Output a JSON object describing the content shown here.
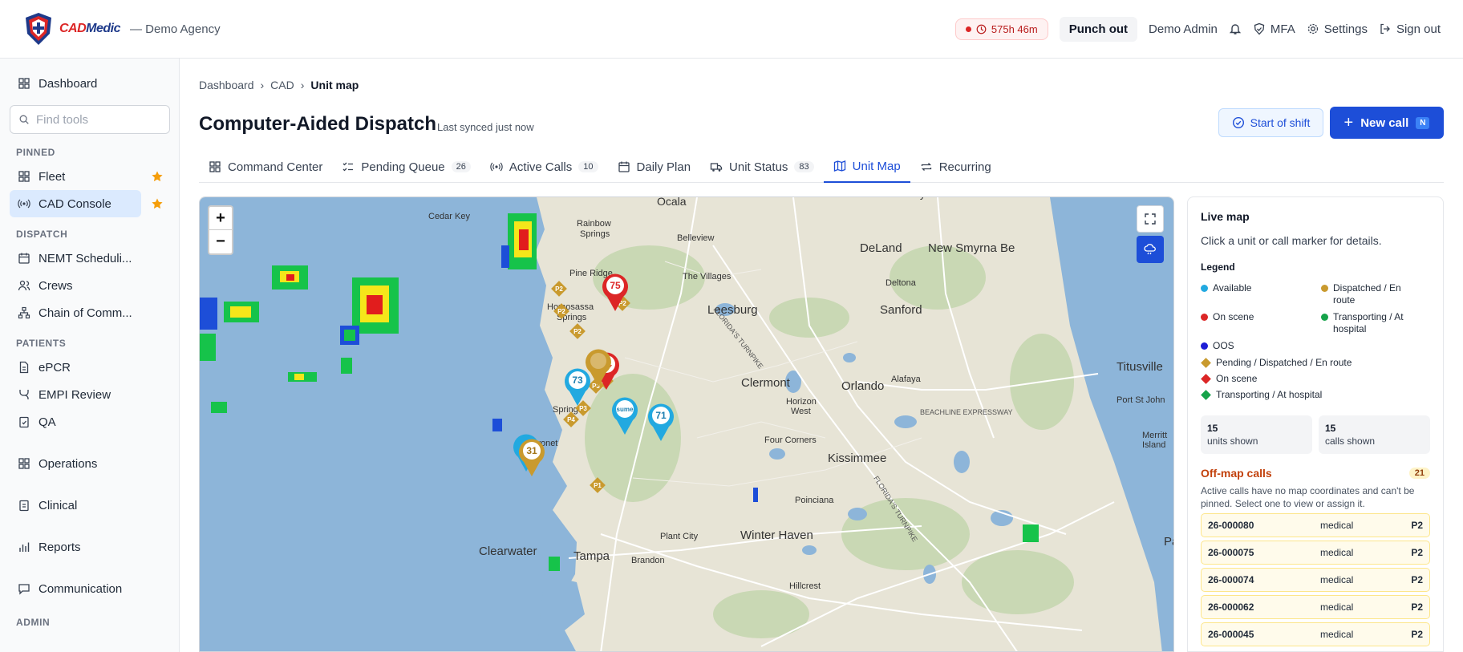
{
  "header": {
    "brand_prefix": "CAD",
    "brand_suffix": "Medic",
    "agency": "— Demo Agency",
    "timer": "575h 46m",
    "punch_out": "Punch out",
    "user": "Demo Admin",
    "mfa": "MFA",
    "settings": "Settings",
    "sign_out": "Sign out"
  },
  "sidebar": {
    "dashboard": "Dashboard",
    "search_placeholder": "Find tools",
    "sections": {
      "pinned": "PINNED",
      "dispatch": "DISPATCH",
      "patients": "PATIENTS",
      "admin": "ADMIN"
    },
    "pinned": [
      "Fleet",
      "CAD Console"
    ],
    "dispatch": [
      "NEMT Scheduli...",
      "Crews",
      "Chain of Comm..."
    ],
    "patients": [
      "ePCR",
      "EMPI Review",
      "QA"
    ],
    "groups": [
      "Operations",
      "Clinical",
      "Reports",
      "Communication"
    ]
  },
  "breadcrumb": [
    "Dashboard",
    "CAD",
    "Unit map"
  ],
  "page": {
    "title": "Computer-Aided Dispatch",
    "synced": "Last synced just now",
    "start_shift": "Start of shift",
    "new_call": "New call",
    "new_call_kbd": "N"
  },
  "tabs": [
    {
      "label": "Command Center",
      "count": null
    },
    {
      "label": "Pending Queue",
      "count": "26"
    },
    {
      "label": "Active Calls",
      "count": "10"
    },
    {
      "label": "Daily Plan",
      "count": null
    },
    {
      "label": "Unit Status",
      "count": "83"
    },
    {
      "label": "Unit Map",
      "count": null
    },
    {
      "label": "Recurring",
      "count": null
    }
  ],
  "map": {
    "zoom_in": "+",
    "zoom_out": "−",
    "places": [
      "Ocala",
      "Cedar Key",
      "Rainbow Springs",
      "Belleview",
      "Daytona Beach",
      "DeLand",
      "New Smyrna Be",
      "Pine Ridge",
      "The Villages",
      "Deltona",
      "Homosassa Springs",
      "Leesburg",
      "Sanford",
      "Clermont",
      "Orlando",
      "Alafaya",
      "Titusville",
      "Horizon West",
      "Port St. John",
      "Four Corners",
      "Kissimmee",
      "Poinciana",
      "Plant City",
      "Winter Haven",
      "Clearwater",
      "Tampa",
      "Brandon",
      "Hillcrest",
      "Spring",
      "Bayonet",
      "Merritt Island",
      "Palm Bay",
      "BEACHLINE EXPRESSWAY",
      "FLORIDA'S TURNPIKE"
    ],
    "unit_markers": [
      "75",
      "74",
      "73",
      "sume",
      "71",
      "31"
    ],
    "call_markers": [
      "P2",
      "P2",
      "P2",
      "P2",
      "P3",
      "P3",
      "P3",
      "P4",
      "P1"
    ]
  },
  "panel": {
    "title": "Live map",
    "hint": "Click a unit or call marker for details.",
    "legend_title": "Legend",
    "legend_units": [
      "Available",
      "Dispatched / En route",
      "On scene",
      "Transporting / At hospital",
      "OOS"
    ],
    "legend_calls": [
      "Pending / Dispatched / En route",
      "On scene",
      "Transporting / At hospital"
    ],
    "units_count": "15",
    "units_label": "units shown",
    "calls_count": "15",
    "calls_label": "calls shown",
    "offmap_title": "Off-map calls",
    "offmap_count": "21",
    "offmap_note": "Active calls have no map coordinates and can't be pinned. Select one to view or assign it.",
    "calls": [
      {
        "id": "26-000080",
        "type": "medical",
        "priority": "P2"
      },
      {
        "id": "26-000075",
        "type": "medical",
        "priority": "P2"
      },
      {
        "id": "26-000074",
        "type": "medical",
        "priority": "P2"
      },
      {
        "id": "26-000062",
        "type": "medical",
        "priority": "P2"
      },
      {
        "id": "26-000045",
        "type": "medical",
        "priority": "P2"
      }
    ]
  },
  "colors": {
    "available": "#22a9e0",
    "dispatched": "#c99a2e",
    "on_scene": "#dc2626",
    "transporting": "#16a34a",
    "oos": "#1d1dd6",
    "primary": "#1d4ed8"
  }
}
